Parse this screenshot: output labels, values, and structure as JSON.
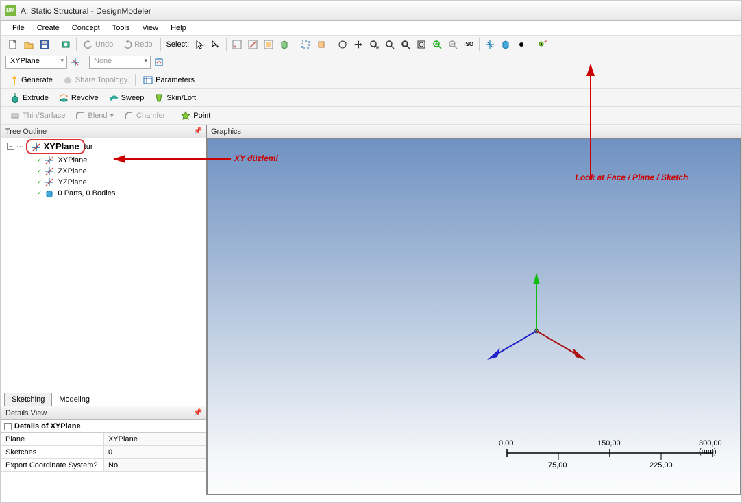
{
  "window": {
    "title": "A: Static Structural - DesignModeler"
  },
  "menubar": {
    "items": [
      "File",
      "Create",
      "Concept",
      "Tools",
      "View",
      "Help"
    ]
  },
  "toolbar1": {
    "undo": "Undo",
    "redo": "Redo",
    "selectLabel": "Select:"
  },
  "toolbar2": {
    "plane": "XYPlane",
    "sketch": "None"
  },
  "toolbar3": {
    "generate": "Generate",
    "shareTopology": "Share Topology",
    "parameters": "Parameters"
  },
  "toolbar4": {
    "extrude": "Extrude",
    "revolve": "Revolve",
    "sweep": "Sweep",
    "skinloft": "Skin/Loft"
  },
  "toolbar5": {
    "thinsurface": "Thin/Surface",
    "blend": "Blend",
    "chamfer": "Chamfer",
    "point": "Point"
  },
  "tree": {
    "title": "Tree Outline",
    "rootSelected": "XYPlane",
    "rootTail": "tur",
    "children": [
      {
        "label": "XYPlane"
      },
      {
        "label": "ZXPlane"
      },
      {
        "label": "YZPlane"
      },
      {
        "label": "0 Parts, 0 Bodies"
      }
    ],
    "tabs": {
      "sketching": "Sketching",
      "modeling": "Modeling"
    }
  },
  "details": {
    "title": "Details View",
    "header": "Details of XYPlane",
    "rows": [
      {
        "k": "Plane",
        "v": "XYPlane"
      },
      {
        "k": "Sketches",
        "v": "0"
      },
      {
        "k": "Export Coordinate System?",
        "v": "No"
      }
    ]
  },
  "graphics": {
    "title": "Graphics"
  },
  "scale": {
    "t0": "0,00",
    "t1": "75,00",
    "t2": "150,00",
    "t3": "225,00",
    "t4": "300,00 (mm)"
  },
  "annotations": {
    "xy": "XY düzlemi",
    "lookat": "Look at Face / Plane / Sketch"
  }
}
